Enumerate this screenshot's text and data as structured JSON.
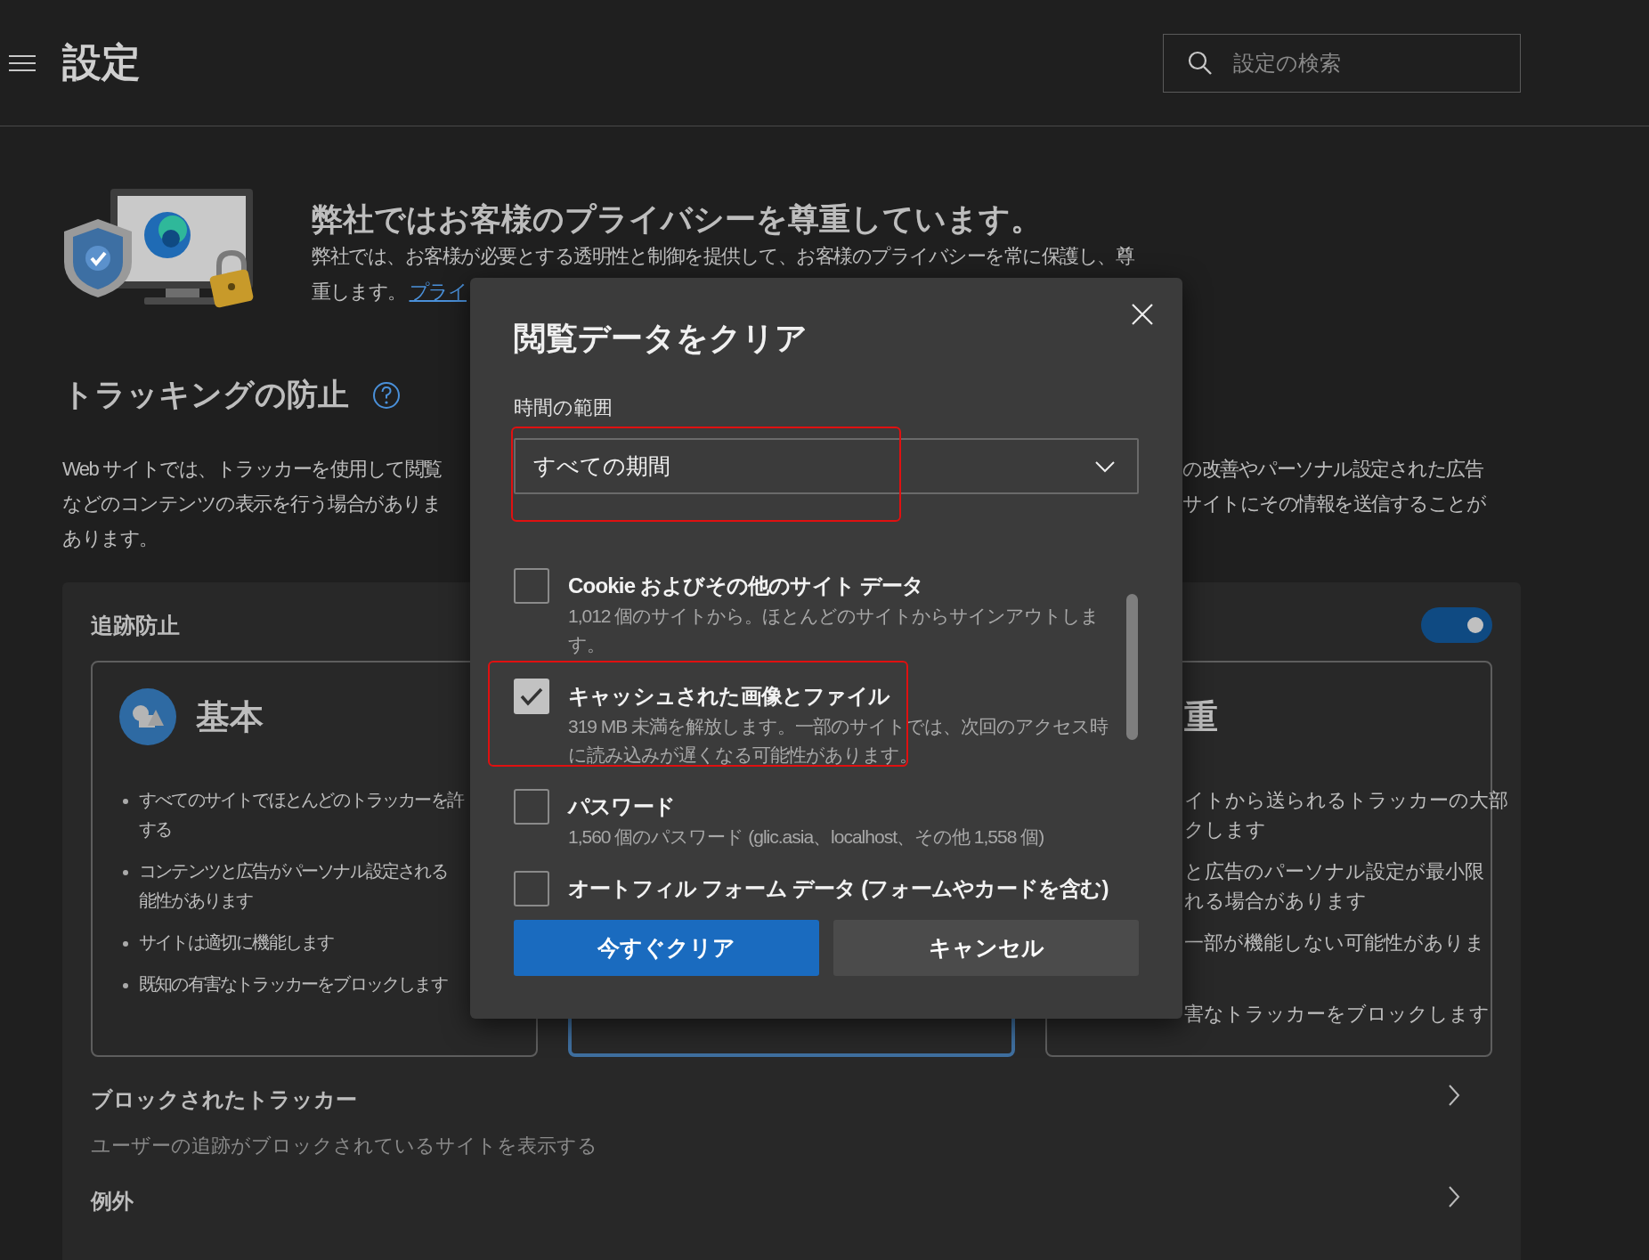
{
  "header": {
    "title": "設定",
    "search": {
      "placeholder": "設定の検索"
    }
  },
  "privacy": {
    "heading": "弊社ではお客様のプライバシーを尊重しています。",
    "lines": [
      "弊社では、お客様が必要とする透明性と制御を提供して、お客様のプライバシーを常に保護し、尊",
      "重します。"
    ],
    "link": "プライ"
  },
  "tracking": {
    "heading": "トラッキングの防止",
    "description_left": [
      "Web サイトでは、トラッカーを使用して閲覧",
      "などのコンテンツの表示を行う場合がありま",
      "あります。"
    ],
    "description_right": [
      "の改善やパーソナル設定された広告",
      "サイトにその情報を送信することが"
    ]
  },
  "protection": {
    "title": "追跡防止",
    "toggle": {
      "on": true
    },
    "options": [
      {
        "title": "基本",
        "selected": false,
        "kind": "basic",
        "bullets": [
          [
            "すべてのサイトでほとんどのトラッカーを許",
            "する"
          ],
          [
            "コンテンツと広告がパーソナル設定される",
            "能性があります"
          ],
          [
            "サイトは適切に機能します"
          ],
          [
            "既知の有害なトラッカーをブロックします"
          ]
        ]
      },
      {
        "selected": true,
        "kind": "hidden"
      },
      {
        "title": "重",
        "selected": false,
        "kind": "partial",
        "bullets": [
          [
            "イトから送られるトラッカーの大部",
            "クします"
          ],
          [
            "と広告のパーソナル設定が最小限",
            "れる場合があります"
          ],
          [
            "一部が機能しない可能性がありま"
          ],
          [
            "害なトラッカーをブロックします"
          ]
        ]
      }
    ],
    "links": [
      {
        "title": "ブロックされたトラッカー",
        "subtitle": "ユーザーの追跡がブロックされているサイトを表示する"
      },
      {
        "title": "例外"
      }
    ]
  },
  "dialog": {
    "title": "閲覧データをクリア",
    "range_label": "時間の範囲",
    "range": {
      "value": "すべての期間",
      "highlighted": true
    },
    "items": [
      {
        "title": "Cookie およびその他のサイト データ",
        "description": "1,012 個のサイトから。ほとんどのサイトからサインアウトします。",
        "checked": false,
        "highlighted": false
      },
      {
        "title": "キャッシュされた画像とファイル",
        "description": "319 MB 未満を解放します。一部のサイトでは、次回のアクセス時に読み込みが遅くなる可能性があります。",
        "checked": true,
        "highlighted": true
      },
      {
        "title": "パスワード",
        "description": "1,560 個のパスワード (glic.asia、localhost、その他 1,558 個)",
        "checked": false,
        "highlighted": false
      },
      {
        "title": "オートフィル フォーム データ (フォームやカードを含む)",
        "checked": false,
        "highlighted": false
      }
    ],
    "buttons": [
      {
        "label": "今すぐクリア",
        "kind": "primary"
      },
      {
        "label": "キャンセル",
        "kind": "secondary"
      }
    ]
  }
}
